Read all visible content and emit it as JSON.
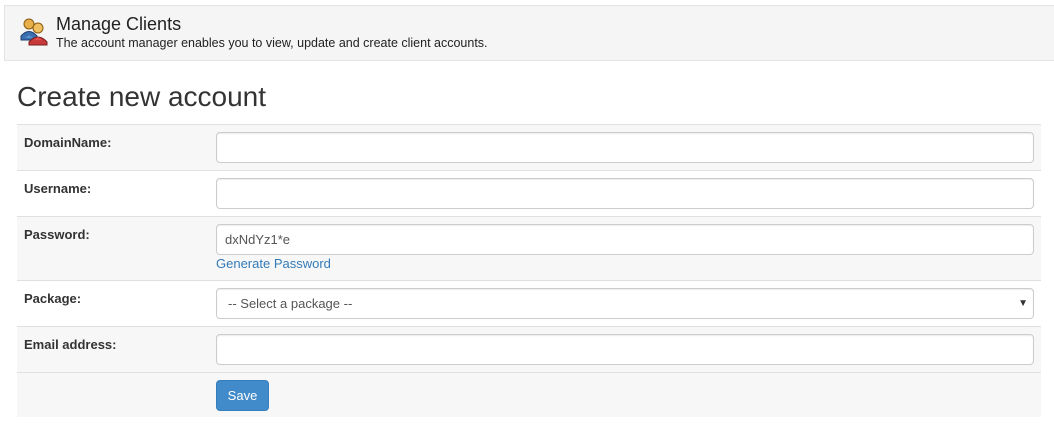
{
  "header": {
    "icon": "users-icon",
    "title": "Manage Clients",
    "description": "The account manager enables you to view, update and create client accounts."
  },
  "page_title": "Create new account",
  "form": {
    "domain": {
      "label": "DomainName:",
      "value": ""
    },
    "username": {
      "label": "Username:",
      "value": ""
    },
    "password": {
      "label": "Password:",
      "value": "dxNdYz1*e",
      "generate_link": "Generate Password"
    },
    "package": {
      "label": "Package:",
      "selected": "-- Select a package --"
    },
    "email": {
      "label": "Email address:",
      "value": ""
    },
    "save_label": "Save"
  },
  "colors": {
    "accent": "#428bca",
    "link": "#337ab7",
    "header_bg": "#f5f5f5"
  }
}
